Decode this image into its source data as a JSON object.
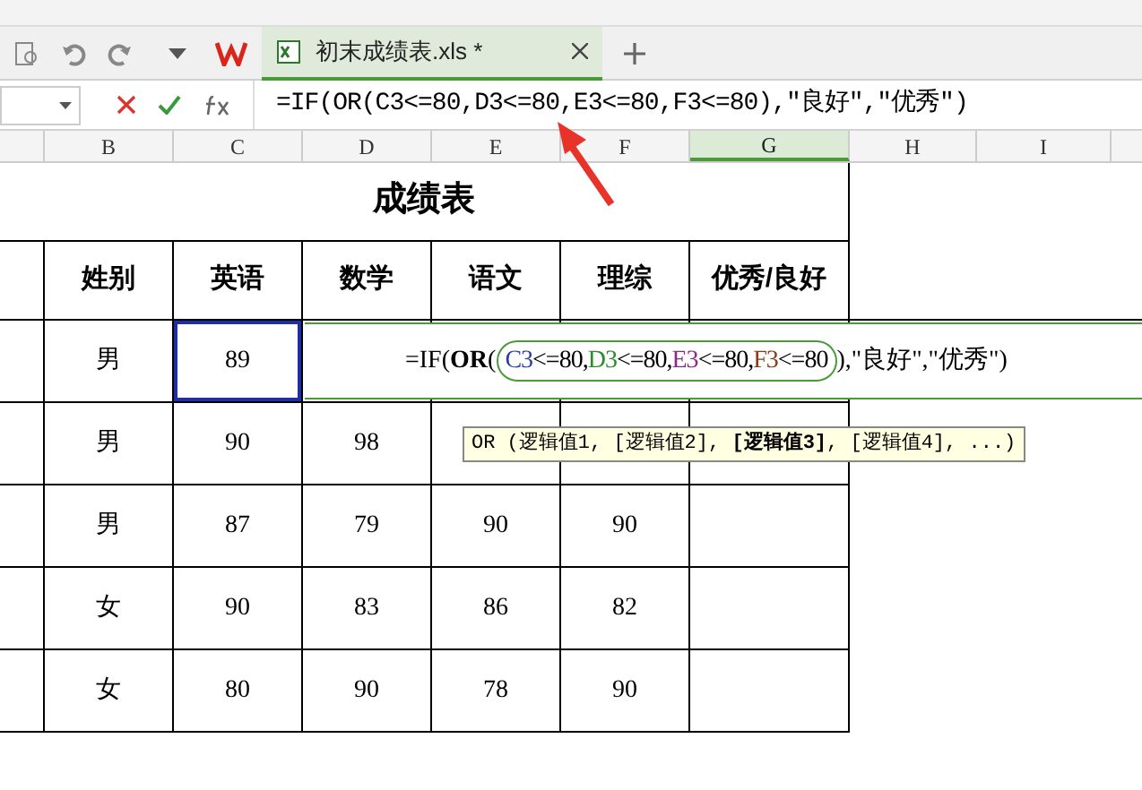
{
  "tabs": [
    {
      "label": "初末成绩表.xls *",
      "selected": true
    }
  ],
  "formula_bar": {
    "formula": "=IF(OR(C3<=80,D3<=80,E3<=80,F3<=80),\"良好\",\"优秀\")"
  },
  "columns": [
    {
      "label": "B",
      "selected": false
    },
    {
      "label": "C",
      "selected": false
    },
    {
      "label": "D",
      "selected": false
    },
    {
      "label": "E",
      "selected": false
    },
    {
      "label": "F",
      "selected": false
    },
    {
      "label": "G",
      "selected": true
    },
    {
      "label": "H",
      "selected": false
    },
    {
      "label": "I",
      "selected": false
    }
  ],
  "sheet": {
    "title": "成绩表",
    "headers": [
      "姓别",
      "英语",
      "数学",
      "语文",
      "理综",
      "优秀/良好"
    ],
    "rows": [
      {
        "cells": [
          {
            "text": "男",
            "selected": false
          },
          {
            "text": "89",
            "selected": true
          }
        ]
      },
      {
        "cells": [
          {
            "text": "男",
            "selected": false
          },
          {
            "text": "90",
            "selected": false
          },
          {
            "text": "98",
            "selected": false
          }
        ]
      },
      {
        "cells": [
          {
            "text": "男",
            "selected": false
          },
          {
            "text": "87",
            "selected": false
          },
          {
            "text": "79",
            "selected": false
          },
          {
            "text": "90",
            "selected": false
          },
          {
            "text": "90",
            "selected": false
          }
        ]
      },
      {
        "cells": [
          {
            "text": "女",
            "selected": false
          },
          {
            "text": "90",
            "selected": false
          },
          {
            "text": "83",
            "selected": false
          },
          {
            "text": "86",
            "selected": false
          },
          {
            "text": "82",
            "selected": false
          }
        ]
      },
      {
        "cells": [
          {
            "text": "女",
            "selected": false
          },
          {
            "text": "80",
            "selected": false
          },
          {
            "text": "90",
            "selected": false
          },
          {
            "text": "78",
            "selected": false
          },
          {
            "text": "90",
            "selected": false
          }
        ]
      }
    ]
  },
  "cell_editor": {
    "prefix": "=IF(**OR**(",
    "args": [
      {
        "ref": "C3",
        "rest": "<=80,",
        "color": "#2b3fa8"
      },
      {
        "ref": "D3",
        "rest": "<=80,",
        "color": "#2e8b2e"
      },
      {
        "ref": "E3",
        "rest": "<=80,",
        "color": "#8b2a8b"
      },
      {
        "ref": "F3",
        "rest": "<=80",
        "color": "#8b3a1a"
      }
    ],
    "suffix": "),\"良好\",\"优秀\")"
  },
  "tooltip": "OR (逻辑值1, [逻辑值2], **[逻辑值3]**, [逻辑值4], ...)"
}
